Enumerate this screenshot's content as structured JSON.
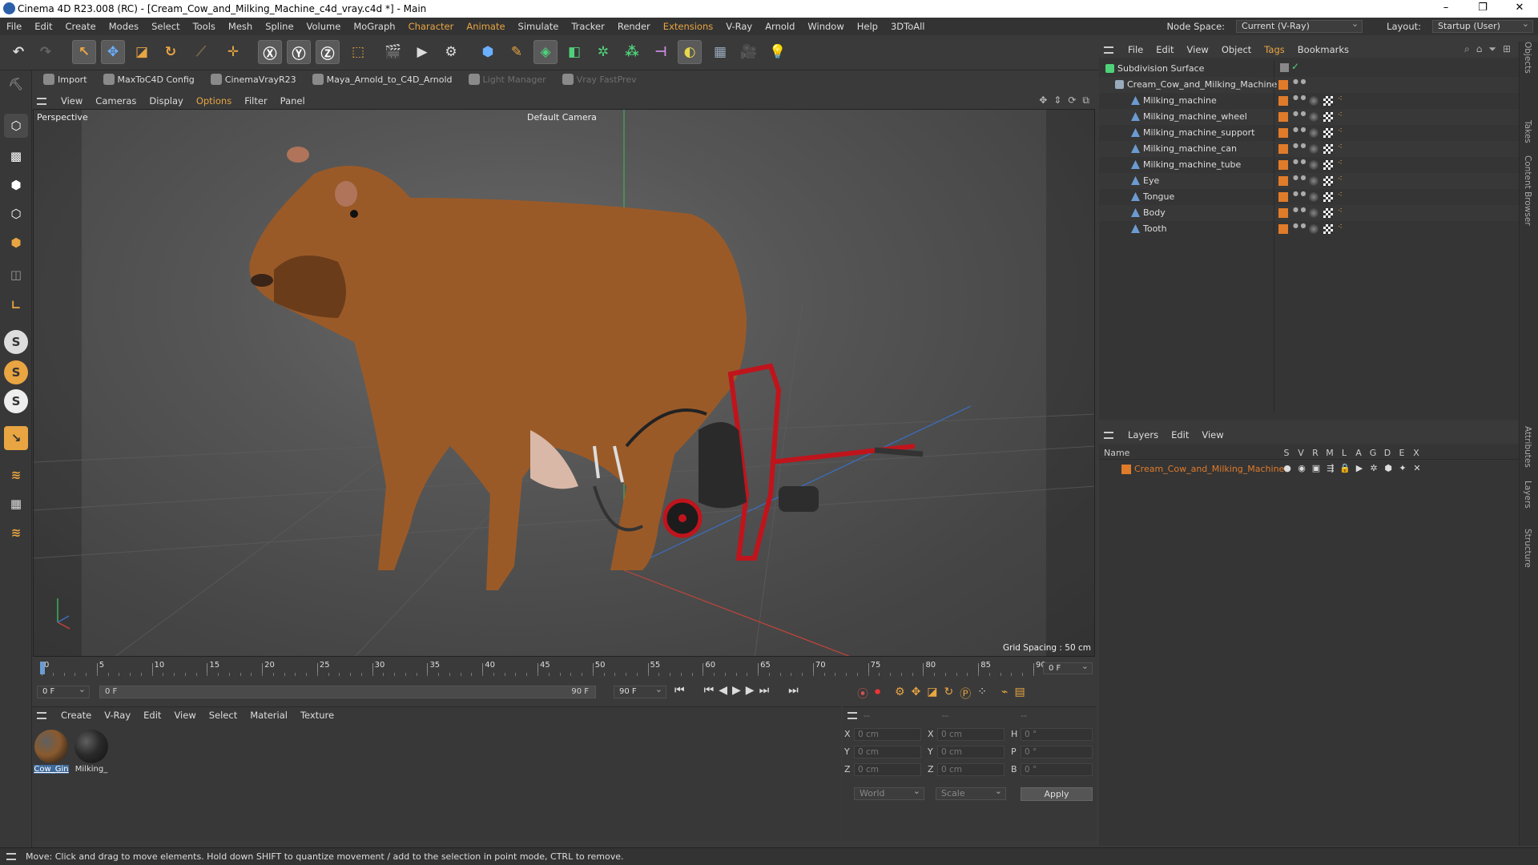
{
  "window": {
    "title": "Cinema 4D R23.008 (RC) - [Cream_Cow_and_Milking_Machine_c4d_vray.c4d *] - Main",
    "controls": [
      "–",
      "❐",
      "✕"
    ]
  },
  "menubar": {
    "items": [
      "File",
      "Edit",
      "Create",
      "Modes",
      "Select",
      "Tools",
      "Mesh",
      "Spline",
      "Volume",
      "MoGraph",
      "Character",
      "Animate",
      "Simulate",
      "Tracker",
      "Render",
      "Extensions",
      "V-Ray",
      "Arnold",
      "Window",
      "Help",
      "3DToAll"
    ],
    "highlighted": [
      "Character",
      "Animate",
      "Extensions"
    ],
    "node_space_label": "Node Space:",
    "node_space_value": "Current (V-Ray)",
    "layout_label": "Layout:",
    "layout_value": "Startup (User)"
  },
  "plugin_bar": {
    "items": [
      {
        "label": "Import",
        "disabled": false
      },
      {
        "label": "MaxToC4D Config",
        "disabled": false
      },
      {
        "label": "CinemaVrayR23",
        "disabled": false
      },
      {
        "label": "Maya_Arnold_to_C4D_Arnold",
        "disabled": false
      },
      {
        "label": "Light Manager",
        "disabled": true
      },
      {
        "label": "Vray FastPrev",
        "disabled": true
      }
    ]
  },
  "viewport": {
    "menu": [
      "View",
      "Cameras",
      "Display",
      "Options",
      "Filter",
      "Panel"
    ],
    "menu_highlighted": "Options",
    "label_perspective": "Perspective",
    "label_camera": "Default Camera",
    "grid_spacing": "Grid Spacing : 50 cm"
  },
  "timeline": {
    "ticks": [
      "0",
      "5",
      "10",
      "15",
      "20",
      "25",
      "30",
      "35",
      "40",
      "45",
      "50",
      "55",
      "60",
      "65",
      "70",
      "75",
      "80",
      "85",
      "90"
    ],
    "current_frame": "0 F",
    "start_field": "0 F",
    "range_start": "0 F",
    "range_end": "90 F",
    "end_field": "90 F"
  },
  "material_panel": {
    "menu": [
      "Create",
      "V-Ray",
      "Edit",
      "View",
      "Select",
      "Material",
      "Texture"
    ],
    "materials": [
      {
        "label": "Cow_Gin",
        "color": "#8a5a2e",
        "selected": true
      },
      {
        "label": "Milking_",
        "color": "#2a2a2a",
        "selected": false
      }
    ]
  },
  "coord_panel": {
    "header": [
      "--",
      "--",
      "--"
    ],
    "rows": [
      {
        "a": "X",
        "av": "0 cm",
        "b": "X",
        "bv": "0 cm",
        "c": "H",
        "cv": "0 °"
      },
      {
        "a": "Y",
        "av": "0 cm",
        "b": "Y",
        "bv": "0 cm",
        "c": "P",
        "cv": "0 °"
      },
      {
        "a": "Z",
        "av": "0 cm",
        "b": "Z",
        "bv": "0 cm",
        "c": "B",
        "cv": "0 °"
      }
    ],
    "mode1": "World",
    "mode2": "Scale",
    "apply": "Apply"
  },
  "object_manager": {
    "menu": [
      "File",
      "Edit",
      "View",
      "Object",
      "Tags",
      "Bookmarks"
    ],
    "menu_highlighted": "Tags",
    "root": "Subdivision Surface",
    "group": "Cream_Cow_and_Milking_Machine",
    "objects": [
      "Milking_machine",
      "Milking_machine_wheel",
      "Milking_machine_support",
      "Milking_machine_can",
      "Milking_machine_tube",
      "Eye",
      "Tongue",
      "Body",
      "Tooth"
    ]
  },
  "layer_manager": {
    "menu": [
      "Layers",
      "Edit",
      "View"
    ],
    "name_header": "Name",
    "columns": [
      "S",
      "V",
      "R",
      "M",
      "L",
      "A",
      "G",
      "D",
      "E",
      "X"
    ],
    "layers": [
      {
        "name": "Cream_Cow_and_Milking_Machine",
        "color": "#e07b2a"
      }
    ]
  },
  "right_tabs": [
    "Objects",
    "Takes",
    "Content Browser",
    "Attributes",
    "Layers",
    "Structure"
  ],
  "status": "Move: Click and drag to move elements. Hold down SHIFT to quantize movement / add to the selection in point mode, CTRL to remove.",
  "colors": {
    "accent": "#e8a542",
    "layer_orange": "#e07b2a",
    "selection_blue": "#6b9bd1"
  }
}
